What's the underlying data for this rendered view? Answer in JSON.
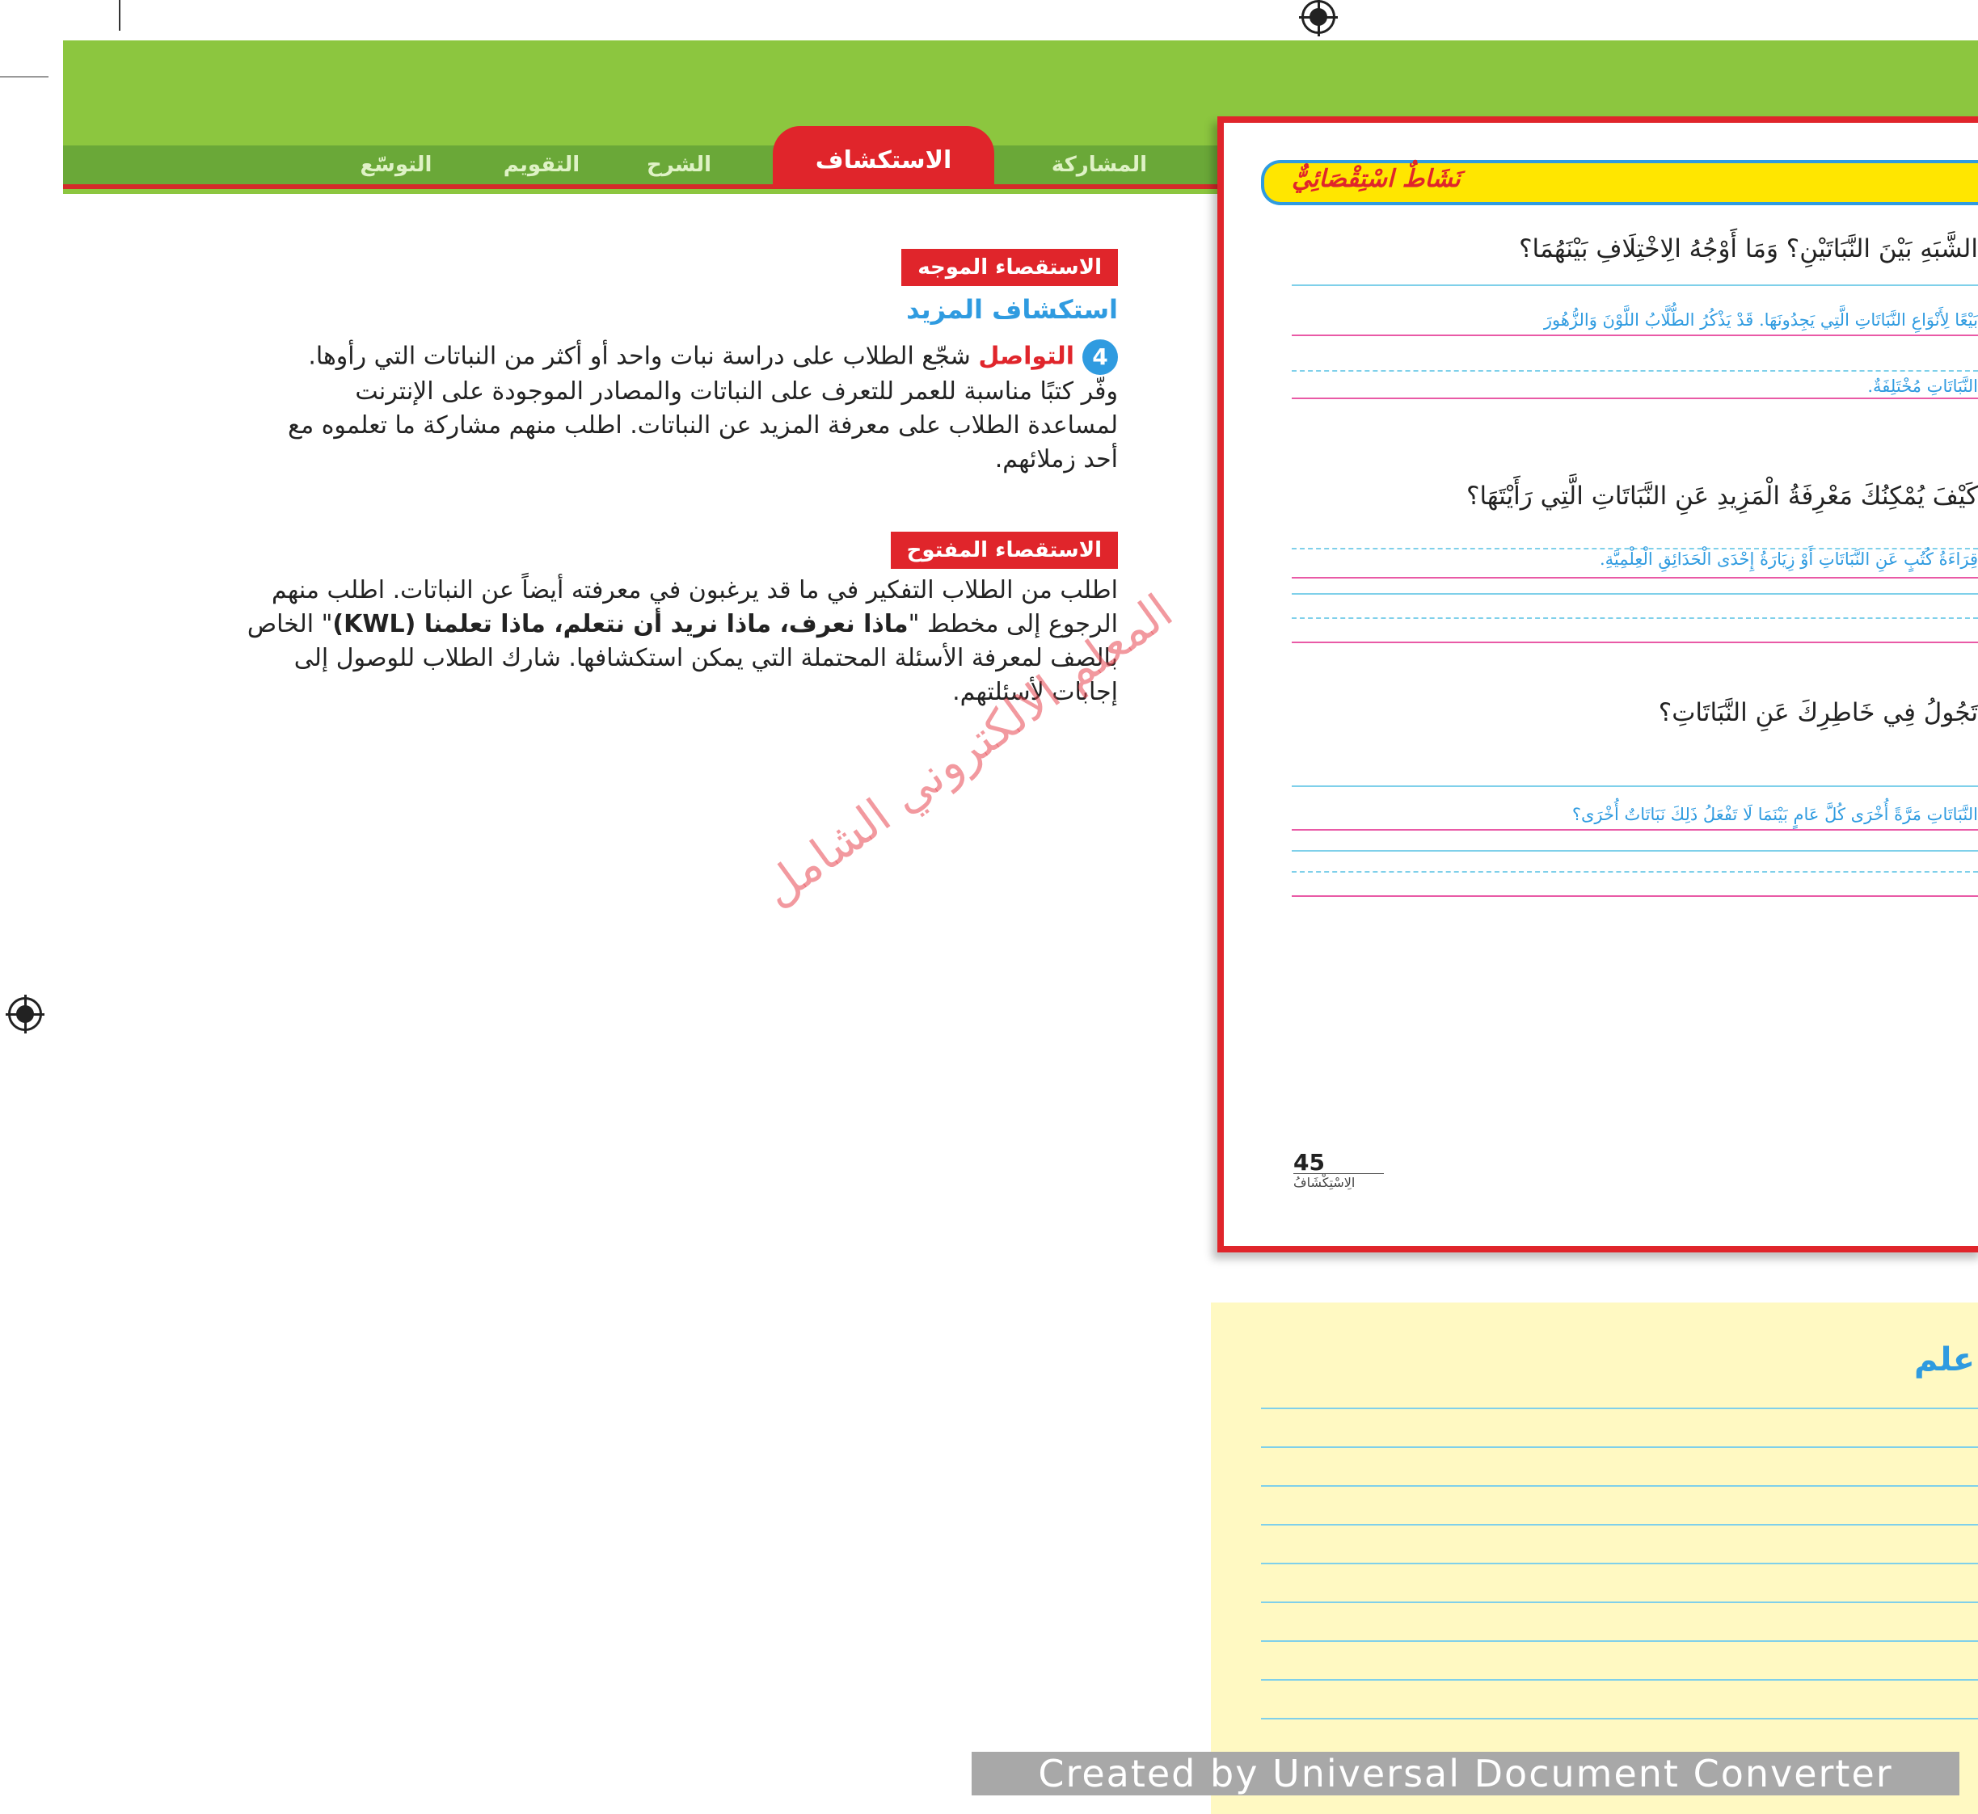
{
  "tabs": {
    "participation": "المشاركة",
    "exploration": "الاستكشاف",
    "explanation": "الشرح",
    "evaluation": "التقويم",
    "extension": "التوسّع"
  },
  "teacher": {
    "guided_label": "الاستقصاء الموجه",
    "explore_more": "استكشاف المزيد",
    "item_number": "4",
    "communication_term": "التواصل",
    "communication_text": "شجّع الطلاب على دراسة نبات واحد أو أكثر من النباتات التي رأوها. وفّر كتبًا مناسبة للعمر للتعرف على النباتات والمصادر الموجودة على الإنترنت لمساعدة الطلاب على معرفة المزيد عن النباتات. اطلب منهم مشاركة ما تعلموه مع أحد زملائهم.",
    "open_label": "الاستقصاء المفتوح",
    "open_text_1": "اطلب من الطلاب التفكير في ما قد يرغبون في معرفته أيضاً عن النباتات. اطلب منهم الرجوع إلى مخطط \"",
    "open_bold": "ماذا نعرف، ماذا نريد أن نتعلم، ماذا تعلمنا (KWL)",
    "open_text_2": "\" الخاص بالصف لمعرفة الأسئلة المحتملة التي يمكن استكشافها. شارك الطلاب للوصول إلى إجابات لأسئلتهم."
  },
  "watermark": "المعلم الالكتروني الشامل",
  "student": {
    "inquiry_title": "نَشَاطٌ اسْتِقْصَائِيٌّ",
    "q1": "الشَّبَهِ بَيْنَ النَّبَاتَيْنِ؟ وَمَا أَوْجُهُ الِاخْتِلَافِ بَيْنَهُمَا؟",
    "a1_line1": "بَيْعًا لِأَنْوَاعِ النَّبَاتَاتِ الَّتِي يَجِدُونَهَا. قَدْ يَذْكُرُ الطُّلَّابُ اللَّوْنَ وَالزُّهُورَ",
    "a1_line2": "النَّبَاتَاتِ مُخْتَلِفَةٌ.",
    "q2": "كَيْفَ يُمْكِنُكَ مَعْرِفَةُ الْمَزِيدِ عَنِ النَّبَاتَاتِ الَّتِي رَأَيْتَهَا؟",
    "a2": "قِرَاءَةُ كُتُبٍ عَنِ النَّبَاتَاتِ أَوْ زِيَارَةُ إِحْدَى الْحَدَائِقِ الْعِلْمِيَّةِ.",
    "q3": "تَجُولُ فِي خَاطِرِكَ عَنِ النَّبَاتَاتِ؟",
    "a3": "النَّبَاتَاتِ مَرَّةً أُخْرَى كُلَّ عَامٍ بَيْنَمَا لَا تَفْعَلُ ذَلِكَ نَبَاتَاتٌ أُخْرَى؟",
    "page_number": "45",
    "page_label": "الِاسْتِكْشَافُ"
  },
  "notes": {
    "heading": "علم"
  },
  "converter_banner": "Created by Universal Document Converter",
  "colors": {
    "green": "#8cc63f",
    "red": "#e0252b",
    "blue": "#2f9be0",
    "yellow": "#ffe600"
  }
}
